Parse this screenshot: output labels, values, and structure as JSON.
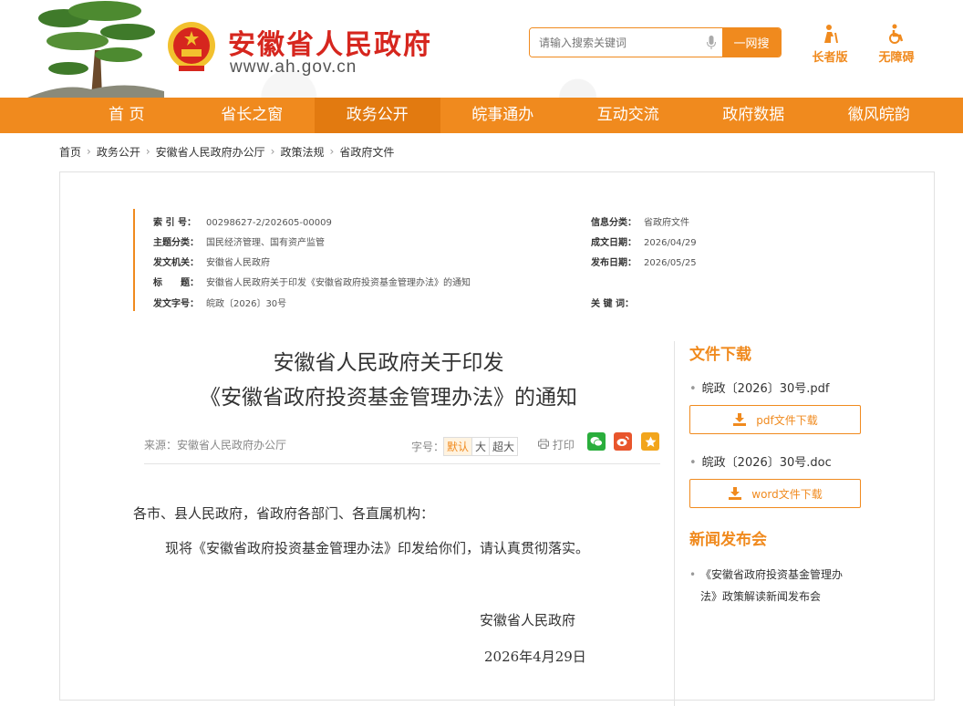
{
  "header": {
    "title": "安徽省人民政府",
    "url": "www.ah.gov.cn",
    "search_placeholder": "请输入搜索关键词",
    "search_button": "一网搜",
    "elder_label": "长者版",
    "access_label": "无障碍"
  },
  "nav": [
    {
      "label": "首 页"
    },
    {
      "label": "省长之窗"
    },
    {
      "label": "政务公开"
    },
    {
      "label": "皖事通办"
    },
    {
      "label": "互动交流"
    },
    {
      "label": "政府数据"
    },
    {
      "label": "徽风皖韵"
    }
  ],
  "breadcrumb": [
    "首页",
    "政务公开",
    "安徽省人民政府办公厅",
    "政策法规",
    "省政府文件"
  ],
  "meta": {
    "index_no_label": "索 引 号：",
    "index_no": "00298627-2/202605-00009",
    "topic_label": "主题分类：",
    "topic": "国民经济管理、国有资产监管",
    "issuer_label": "发文机关：",
    "issuer": "安徽省人民政府",
    "title_label": "标　　题：",
    "title": "安徽省人民政府关于印发《安徽省政府投资基金管理办法》的通知",
    "doc_no_label": "发文字号：",
    "doc_no": "皖政〔2026〕30号",
    "category_label": "信息分类：",
    "category": "省政府文件",
    "written_label": "成文日期：",
    "written": "2026/04/29",
    "published_label": "发布日期：",
    "published": "2026/05/25",
    "keywords_label": "关 键 词：",
    "keywords": ""
  },
  "doc": {
    "title_line1": "安徽省人民政府关于印发",
    "title_line2": "《安徽省政府投资基金管理办法》的通知",
    "source": "来源：安徽省人民政府办公厅",
    "font_label": "字号：",
    "font_default": "默认",
    "font_large": "大",
    "font_xlarge": "超大",
    "print": "打印",
    "salutation": "各市、县人民政府，省政府各部门、各直属机构：",
    "paragraph": "现将《安徽省政府投资基金管理办法》印发给你们，请认真贯彻落实。",
    "signature": "安徽省人民政府",
    "date": "2026年4月29日"
  },
  "side": {
    "download_title": "文件下载",
    "pdf_name": "皖政〔2026〕30号.pdf",
    "pdf_button": "pdf文件下载",
    "doc_name": "皖政〔2026〕30号.doc",
    "doc_button": "word文件下载",
    "news_title": "新闻发布会",
    "news_item": "《安徽省政府投资基金管理办法》政策解读新闻发布会"
  },
  "colors": {
    "accent": "#f08a1e",
    "brand_red": "#d6261e"
  }
}
